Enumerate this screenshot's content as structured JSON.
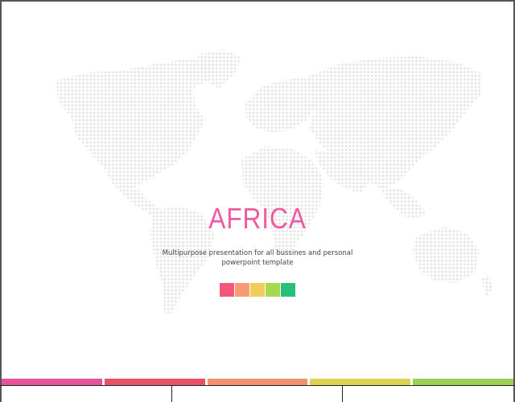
{
  "slide": {
    "title": "AFRICA",
    "subtitle_line1": "Multipurpose presentation for all bussines and personal",
    "subtitle_line2": "powerpoint template",
    "title_color": "#ee5ba0",
    "map_dot_color": "#e6e6e6"
  },
  "swatches": [
    "#f4567a",
    "#f79a76",
    "#f3cb58",
    "#a6d852",
    "#25c07b"
  ],
  "stripes": [
    "#e7529b",
    "#e85267",
    "#f0936a",
    "#dcd353",
    "#9ccf56"
  ]
}
